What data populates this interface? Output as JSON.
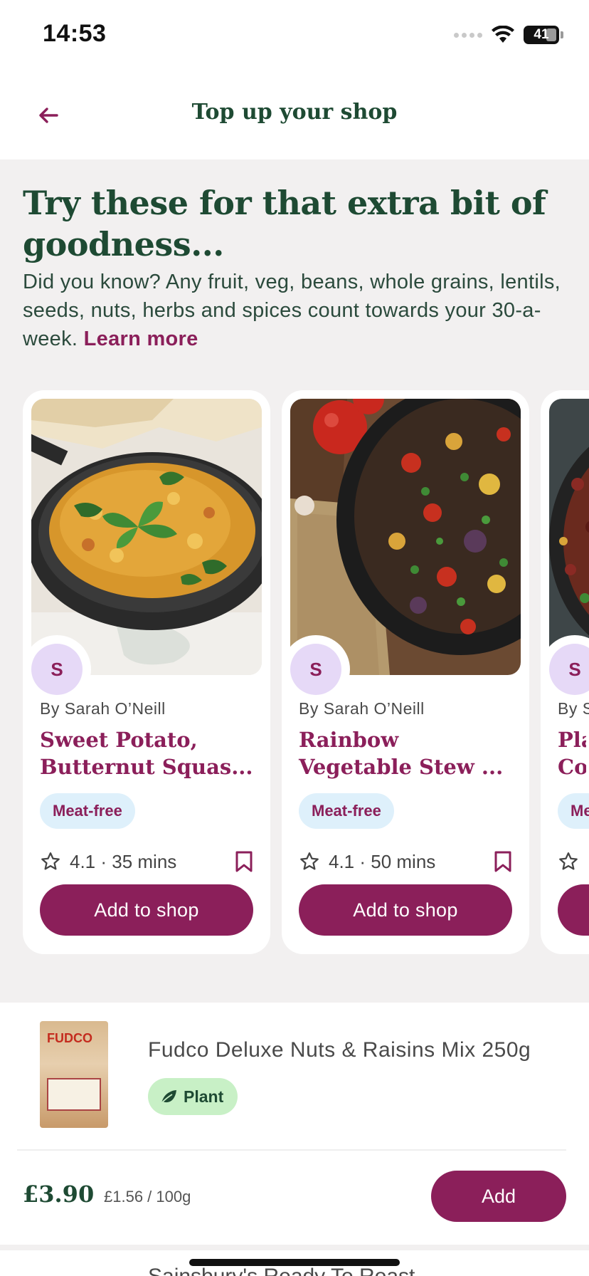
{
  "status": {
    "time": "14:53",
    "battery": "41"
  },
  "header": {
    "title": "Top up your shop",
    "back_icon": "arrow-left-icon"
  },
  "hero": {
    "heading": "Try these for that extra bit of goodness...",
    "text": "Did you know? Any fruit, veg, beans, whole grains, lentils, seeds, nuts, herbs and spices count towards your 30-a-week.",
    "learn_more": "Learn more"
  },
  "recipes": [
    {
      "avatar": "S",
      "author": "By Sarah O’Neill",
      "title": "Sweet Potato, Butternut Squas...",
      "tag": "Meat-free",
      "rating": "4.1 · 35 mins",
      "button": "Add to shop"
    },
    {
      "avatar": "S",
      "author": "By Sarah O’Neill",
      "title": "Rainbow Vegetable Stew ...",
      "tag": "Meat-free",
      "rating": "4.1 · 50 mins",
      "button": "Add to shop"
    },
    {
      "avatar": "S",
      "author": "By S",
      "title": "Pla Co",
      "tag": "Me",
      "rating": "·"
    }
  ],
  "product": {
    "name": "Fudco Deluxe Nuts & Raisins Mix 250g",
    "brand": "FUDCO",
    "badge": "Plant",
    "price": "£3.90",
    "unit_price": "£1.56 / 100g",
    "add_label": "Add"
  },
  "next_product": {
    "name": "Sainsbury's Ready To Roast"
  },
  "colors": {
    "brand": "#8b1f5a",
    "heading": "#1e4a33",
    "tag_bg": "#def0fb",
    "plant_bg": "#c8f0c6"
  }
}
